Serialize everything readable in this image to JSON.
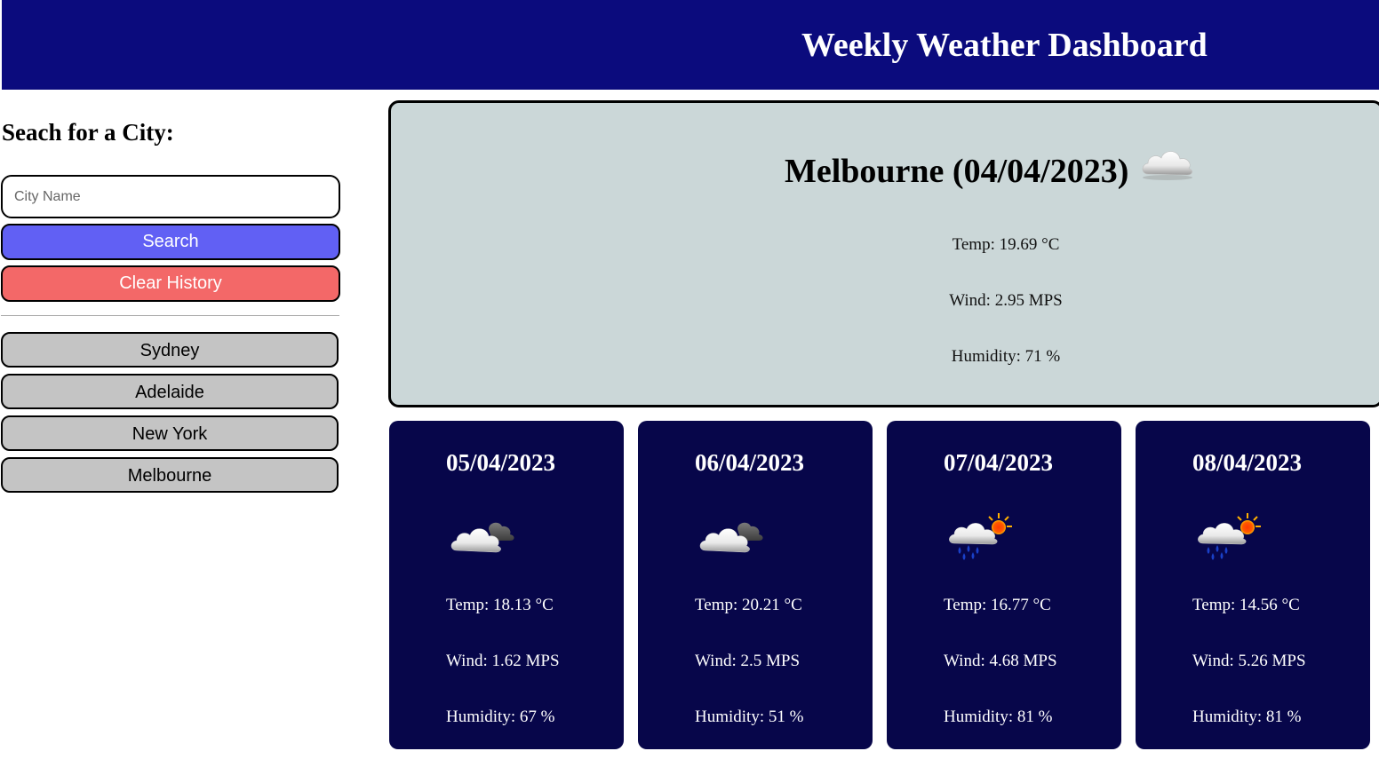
{
  "header": {
    "title": "Weekly Weather Dashboard"
  },
  "sidebar": {
    "heading": "Seach for a City:",
    "search_input": {
      "value": "",
      "placeholder": "City Name"
    },
    "search_button": "Search",
    "clear_button": "Clear History",
    "history": [
      "Sydney",
      "Adelaide",
      "New York",
      "Melbourne"
    ]
  },
  "current": {
    "title": "Melbourne (04/04/2023)",
    "icon": "cloud-icon",
    "temp": "Temp: 19.69 °C",
    "wind": "Wind: 2.95 MPS",
    "humidity": "Humidity: 71 %"
  },
  "forecast": [
    {
      "date": "05/04/2023",
      "icon": "partly-cloudy-icon",
      "temp": "Temp: 18.13 °C",
      "wind": "Wind: 1.62 MPS",
      "humidity": "Humidity: 67 %"
    },
    {
      "date": "06/04/2023",
      "icon": "partly-cloudy-icon",
      "temp": "Temp: 20.21 °C",
      "wind": "Wind: 2.5 MPS",
      "humidity": "Humidity: 51 %"
    },
    {
      "date": "07/04/2023",
      "icon": "rain-sun-icon",
      "temp": "Temp: 16.77 °C",
      "wind": "Wind: 4.68 MPS",
      "humidity": "Humidity: 81 %"
    },
    {
      "date": "08/04/2023",
      "icon": "rain-sun-icon",
      "temp": "Temp: 14.56 °C",
      "wind": "Wind: 5.26 MPS",
      "humidity": "Humidity: 81 %"
    }
  ],
  "colors": {
    "header_bg": "#0b0b7d",
    "search_button": "#6160f4",
    "clear_button": "#f36868",
    "history_button": "#c4c4c4",
    "current_bg": "#cbd7d8",
    "card_bg": "#07064a"
  }
}
